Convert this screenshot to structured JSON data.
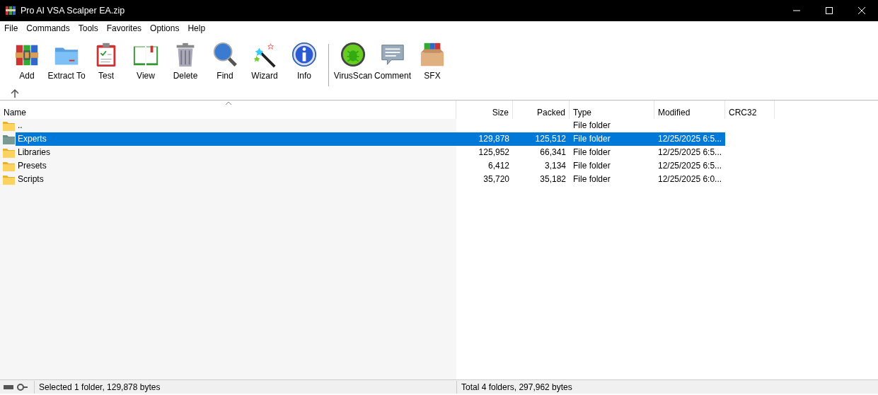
{
  "window": {
    "title": "Pro AI VSA Scalper EA.zip"
  },
  "menu": [
    "File",
    "Commands",
    "Tools",
    "Favorites",
    "Options",
    "Help"
  ],
  "toolbar": [
    {
      "label": "Add"
    },
    {
      "label": "Extract To"
    },
    {
      "label": "Test"
    },
    {
      "label": "View"
    },
    {
      "label": "Delete"
    },
    {
      "label": "Find"
    },
    {
      "label": "Wizard"
    },
    {
      "label": "Info"
    },
    {
      "label": "VirusScan"
    },
    {
      "label": "Comment"
    },
    {
      "label": "SFX"
    }
  ],
  "table": {
    "columns": [
      "Name",
      "Size",
      "Packed",
      "Type",
      "Modified",
      "CRC32"
    ],
    "rows": [
      {
        "name": "..",
        "size": "",
        "packed": "",
        "type": "File folder",
        "modified": "",
        "selected": false
      },
      {
        "name": "Experts",
        "size": "129,878",
        "packed": "125,512",
        "type": "File folder",
        "modified": "12/25/2025 6:5...",
        "selected": true
      },
      {
        "name": "Libraries",
        "size": "125,952",
        "packed": "66,341",
        "type": "File folder",
        "modified": "12/25/2025 6:5...",
        "selected": false
      },
      {
        "name": "Presets",
        "size": "6,412",
        "packed": "3,134",
        "type": "File folder",
        "modified": "12/25/2025 6:5...",
        "selected": false
      },
      {
        "name": "Scripts",
        "size": "35,720",
        "packed": "35,182",
        "type": "File folder",
        "modified": "12/25/2025 6:0...",
        "selected": false
      }
    ]
  },
  "status_bar": {
    "left": "Selected 1 folder, 129,878 bytes",
    "right": "Total 4 folders, 297,962 bytes"
  }
}
